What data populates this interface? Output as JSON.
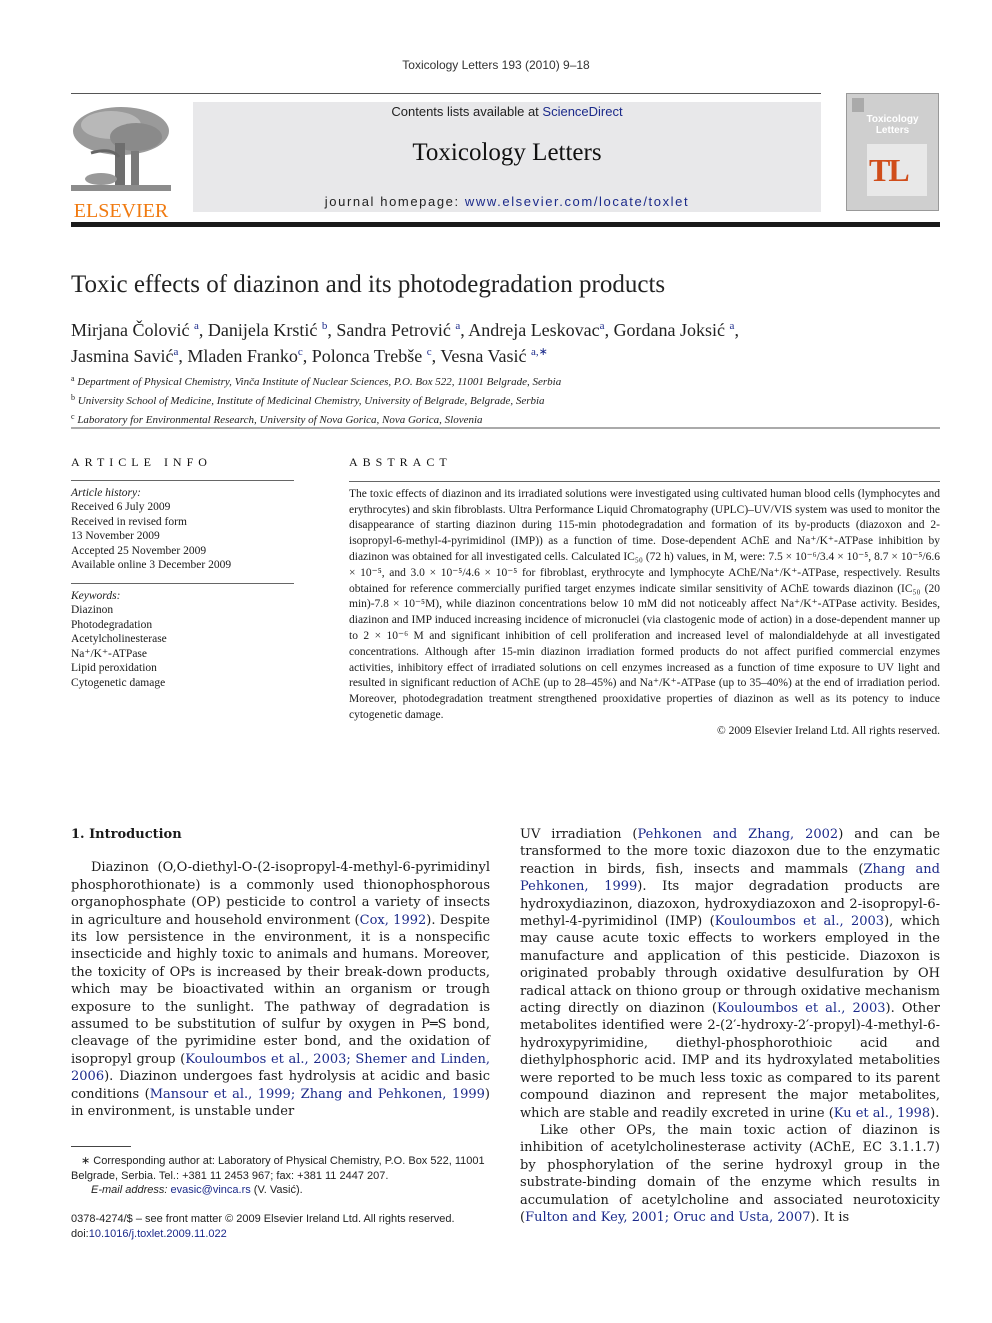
{
  "header": {
    "running_head": "Toxicology Letters 193 (2010) 9–18",
    "publisher_logo_text": "ELSEVIER",
    "contents_prefix": "Contents lists available at ",
    "contents_link": "ScienceDirect",
    "journal_title": "Toxicology Letters",
    "homepage_prefix": "journal homepage: ",
    "homepage_link": "www.elsevier.com/locate/toxlet",
    "cover": {
      "title_line1": "Toxicology",
      "title_line2": "Letters",
      "monogram": "TL",
      "accent_color": "#d04d1a"
    },
    "brand_color": "#f07a10",
    "link_color": "#1b2a8a"
  },
  "article": {
    "title": "Toxic effects of diazinon and its photodegradation products",
    "authors": [
      {
        "name": "Mirjana Čolović",
        "sup": "a",
        "sep": ", "
      },
      {
        "name": "Danijela Krstić",
        "sup": "b",
        "sep": ", "
      },
      {
        "name": "Sandra Petrović",
        "sup": "a",
        "sep": ", "
      },
      {
        "name": "Andreja Leskovac",
        "sup": "a",
        "sep": ", "
      },
      {
        "name": "Gordana Joksić",
        "sup": "a",
        "sep": ","
      },
      {
        "name": "Jasmina Savić",
        "sup": "a",
        "sep": ", "
      },
      {
        "name": "Mladen Franko",
        "sup": "c",
        "sep": ", "
      },
      {
        "name": "Polonca Trebše",
        "sup": "c",
        "sep": ", "
      },
      {
        "name": "Vesna Vasić",
        "sup": "a,∗",
        "sep": ""
      }
    ],
    "affiliations": [
      {
        "sup": "a",
        "text": "Department of Physical Chemistry, Vinča Institute of Nuclear Sciences, P.O. Box 522, 11001 Belgrade, Serbia"
      },
      {
        "sup": "b",
        "text": "University School of Medicine, Institute of Medicinal Chemistry, University of Belgrade, Belgrade, Serbia"
      },
      {
        "sup": "c",
        "text": "Laboratory for Environmental Research, University of Nova Gorica, Nova Gorica, Slovenia"
      }
    ]
  },
  "article_info": {
    "heading": "ARTICLE INFO",
    "history_label": "Article history:",
    "history": [
      "Received 6 July 2009",
      "Received in revised form",
      "13 November 2009",
      "Accepted 25 November 2009",
      "Available online 3 December 2009"
    ],
    "keywords_label": "Keywords:",
    "keywords": [
      "Diazinon",
      "Photodegradation",
      "Acetylcholinesterase",
      "Na⁺/K⁺-ATPase",
      "Lipid peroxidation",
      "Cytogenetic damage"
    ]
  },
  "abstract": {
    "heading": "ABSTRACT",
    "text": "The toxic effects of diazinon and its irradiated solutions were investigated using cultivated human blood cells (lymphocytes and erythrocytes) and skin fibroblasts. Ultra Performance Liquid Chromatography (UPLC)–UV/VIS system was used to monitor the disappearance of starting diazinon during 115-min photodegradation and formation of its by-products (diazoxon and 2-isopropyl-6-methyl-4-pyrimidinol (IMP)) as a function of time. Dose-dependent AChE and Na⁺/K⁺-ATPase inhibition by diazinon was obtained for all investigated cells. Calculated IC₅₀ (72 h) values, in M, were: 7.5 × 10⁻⁶/3.4 × 10⁻⁵, 8.7 × 10⁻⁵/6.6 × 10⁻⁵, and 3.0 × 10⁻⁵/4.6 × 10⁻⁵ for fibroblast, erythrocyte and lymphocyte AChE/Na⁺/K⁺-ATPase, respectively. Results obtained for reference commercially purified target enzymes indicate similar sensitivity of AChE towards diazinon (IC₅₀ (20 min)-7.8 × 10⁻⁵M), while diazinon concentrations below 10 mM did not noticeably affect Na⁺/K⁺-ATPase activity. Besides, diazinon and IMP induced increasing incidence of micronuclei (via clastogenic mode of action) in a dose-dependent manner up to 2 × 10⁻⁶ M and significant inhibition of cell proliferation and increased level of malondialdehyde at all investigated concentrations. Although after 15-min diazinon irradiation formed products do not affect purified commercial enzymes activities, inhibitory effect of irradiated solutions on cell enzymes increased as a function of time exposure to UV light and resulted in significant reduction of AChE (up to 28–45%) and Na⁺/K⁺-ATPase (up to 35–40%) at the end of irradiation period. Moreover, photodegradation treatment strengthened prooxidative properties of diazinon as well as its potency to induce cytogenetic damage.",
    "copyright": "© 2009 Elsevier Ireland Ltd. All rights reserved."
  },
  "body": {
    "section_title": "1.  Introduction",
    "left_paragraph": [
      {
        "t": "Diazinon (O,O-diethyl-O-(2-isopropyl-4-methyl-6-pyrimidinyl phosphorothionate) is a commonly used thionophosphorous organophosphate (OP) pesticide to control a variety of insects in agriculture and household environment ("
      },
      {
        "link": "Cox, 1992"
      },
      {
        "t": "). Despite its low persistence in the environment, it is a nonspecific insecticide and highly toxic to animals and humans. Moreover, the toxicity of OPs is increased by their break-down products, which may be bioactivated within an organism or trough exposure to the sunlight. The pathway of degradation is assumed to be substitution of sulfur by oxygen in P═S bond, cleavage of the pyrimidine ester bond, and the oxidation of isopropyl group ("
      },
      {
        "link": "Kouloumbos et al., 2003; Shemer and Linden, 2006"
      },
      {
        "t": "). Diazinon undergoes fast hydrolysis at acidic and basic conditions ("
      },
      {
        "link": "Mansour et al., 1999; Zhang and Pehkonen, 1999"
      },
      {
        "t": ") in environment, is unstable under"
      }
    ],
    "right_paragraph_1": [
      {
        "t": "UV irradiation ("
      },
      {
        "link": "Pehkonen and Zhang, 2002"
      },
      {
        "t": ") and can be transformed to the more toxic diazoxon due to the enzymatic reaction in birds, fish, insects and mammals ("
      },
      {
        "link": "Zhang and Pehkonen, 1999"
      },
      {
        "t": "). Its major degradation products are hydroxydiazinon, diazoxon, hydroxydiazoxon and 2-isopropyl-6-methyl-4-pyrimidinol (IMP) ("
      },
      {
        "link": "Kouloumbos et al., 2003"
      },
      {
        "t": "), which may cause acute toxic effects to workers employed in the manufacture and application of this pesticide. Diazoxon is originated probably through oxidative desulfuration by OH radical attack on thiono group or through oxidative mechanism acting directly on diazinon ("
      },
      {
        "link": "Kouloumbos et al., 2003"
      },
      {
        "t": "). Other metabolites identified were 2-(2′-hydroxy-2′-propyl)-4-methyl-6-hydroxypyrimidine, diethyl-phosphorothioic acid and diethylphosphoric acid. IMP and its hydroxylated metabolities were reported to be much less toxic as compared to its parent compound diazinon and represent the major metabolites, which are stable and readily excreted in urine ("
      },
      {
        "link": "Ku et al., 1998"
      },
      {
        "t": ")."
      }
    ],
    "right_paragraph_2": [
      {
        "t": "Like other OPs, the main toxic action of diazinon is inhibition of acetylcholinesterase activity (AChE, EC 3.1.1.7) by phosphorylation of the serine hydroxyl group in the substrate-binding domain of the enzyme which results in accumulation of acetylcholine and associated neurotoxicity ("
      },
      {
        "link": "Fulton and Key, 2001; Oruc and Usta, 2007"
      },
      {
        "t": "). It is"
      }
    ]
  },
  "footnote": {
    "corresponding": "∗  Corresponding author at: Laboratory of Physical Chemistry, P.O. Box 522, 11001 Belgrade, Serbia. Tel.: +381 11 2453 967; fax: +381 11 2447 207.",
    "email_label": "E-mail address:",
    "email": "evasic@vinca.rs",
    "email_suffix": " (V. Vasić)."
  },
  "front_matter": {
    "issn_line": "0378-4274/$ – see front matter © 2009 Elsevier Ireland Ltd. All rights reserved.",
    "doi_prefix": "doi:",
    "doi": "10.1016/j.toxlet.2009.11.022"
  }
}
